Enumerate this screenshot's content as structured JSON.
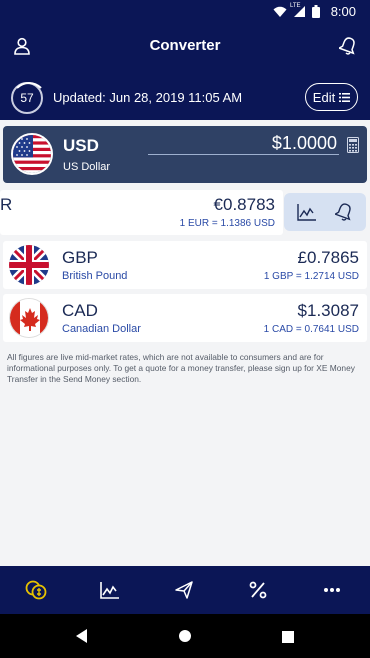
{
  "status_bar": {
    "time": "8:00",
    "network_label": "LTE"
  },
  "header": {
    "title": "Converter"
  },
  "update": {
    "timer": "57",
    "text": "Updated: Jun 28, 2019 11:05 AM",
    "edit_label": "Edit"
  },
  "base": {
    "code": "USD",
    "name": "US Dollar",
    "amount": "$1.0000"
  },
  "rows": [
    {
      "code": "R",
      "amount": "€0.8783",
      "rate": "1 EUR = 1.1386 USD"
    },
    {
      "code": "GBP",
      "name": "British Pound",
      "amount": "£0.7865",
      "rate": "1 GBP = 1.2714 USD"
    },
    {
      "code": "CAD",
      "name": "Canadian Dollar",
      "amount": "$1.3087",
      "rate": "1 CAD = 0.7641 USD"
    }
  ],
  "disclaimer": "All figures are live mid-market rates, which are not available to consumers and are for informational purposes only. To get a quote for a money transfer, please sign up for XE Money Transfer in the Send Money section.",
  "colors": {
    "navy": "#0b1656",
    "card": "#2f4165",
    "accent_gold": "#e8c300",
    "link_blue": "#2a4aa6"
  },
  "icons": [
    "wifi-icon",
    "signal-icon",
    "battery-icon",
    "user-icon",
    "bell-icon",
    "list-icon",
    "calculator-icon",
    "chart-icon",
    "coins-icon",
    "send-icon",
    "percent-icon",
    "more-icon",
    "back-icon",
    "home-icon",
    "recents-icon"
  ]
}
